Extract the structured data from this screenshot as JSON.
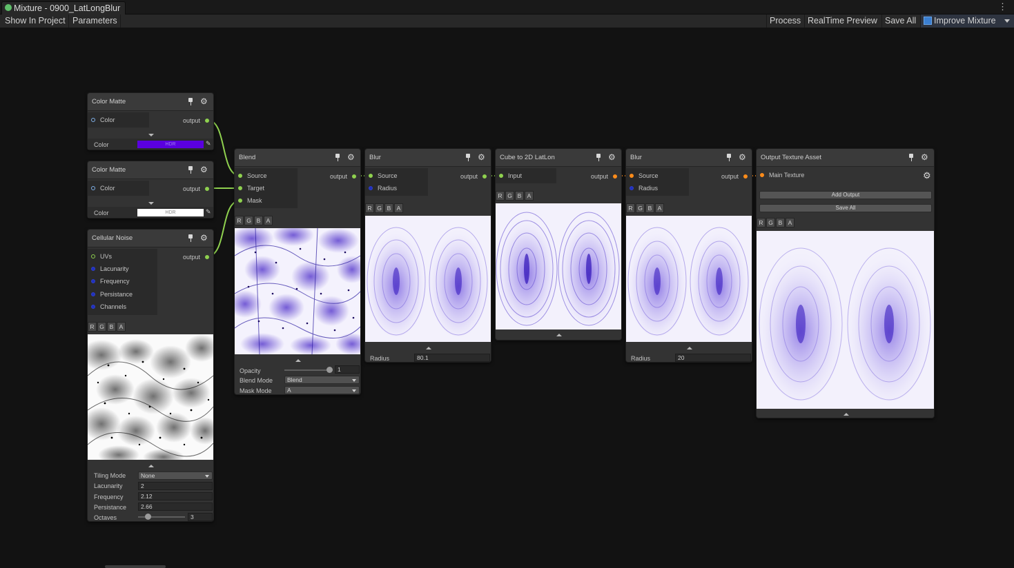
{
  "window": {
    "tab_title": "Mixture - 0900_LatLongBlur",
    "menu_icon": "kebab-icon"
  },
  "toolbar": {
    "show_in_project": "Show In Project",
    "parameters": "Parameters",
    "process": "Process",
    "realtime_preview": "RealTime Preview",
    "save_all": "Save All",
    "improve_mixture": "Improve Mixture"
  },
  "channels": [
    "R",
    "G",
    "B",
    "A"
  ],
  "colors": {
    "wire_green": "#8fd14f",
    "wire_orange": "#ff8c1a",
    "matte_purple": "#5a00e0",
    "matte_white": "#ffffff"
  },
  "nodes": {
    "color_matte_1": {
      "title": "Color Matte",
      "input": "Color",
      "output": "output",
      "prop_label": "Color",
      "hdr": "HDR"
    },
    "color_matte_2": {
      "title": "Color Matte",
      "input": "Color",
      "output": "output",
      "prop_label": "Color",
      "hdr": "HDR"
    },
    "cellular_noise": {
      "title": "Cellular Noise",
      "inputs": [
        "UVs",
        "Lacunarity",
        "Frequency",
        "Persistance",
        "Channels"
      ],
      "output": "output",
      "tiling_mode_label": "Tiling Mode",
      "tiling_mode": "None",
      "lacunarity_label": "Lacunarity",
      "lacunarity": "2",
      "frequency_label": "Frequency",
      "frequency": "2.12",
      "persistance_label": "Persistance",
      "persistance": "2.66",
      "octaves_label": "Octaves",
      "octaves": "3"
    },
    "blend": {
      "title": "Blend",
      "inputs": [
        "Source",
        "Target",
        "Mask"
      ],
      "output": "output",
      "opacity_label": "Opacity",
      "opacity": "1",
      "blend_mode_label": "Blend Mode",
      "blend_mode": "Blend",
      "mask_mode_label": "Mask Mode",
      "mask_mode": "A"
    },
    "blur_1": {
      "title": "Blur",
      "inputs": [
        "Source",
        "Radius"
      ],
      "output": "output",
      "radius_label": "Radius",
      "radius": "80.1"
    },
    "cube_to_latlon": {
      "title": "Cube to 2D LatLon",
      "input": "Input",
      "output": "output"
    },
    "blur_2": {
      "title": "Blur",
      "inputs": [
        "Source",
        "Radius"
      ],
      "output": "output",
      "radius_label": "Radius",
      "radius": "20"
    },
    "output_texture": {
      "title": "Output Texture Asset",
      "input": "Main Texture",
      "add_output": "Add Output",
      "save_all": "Save All"
    }
  }
}
